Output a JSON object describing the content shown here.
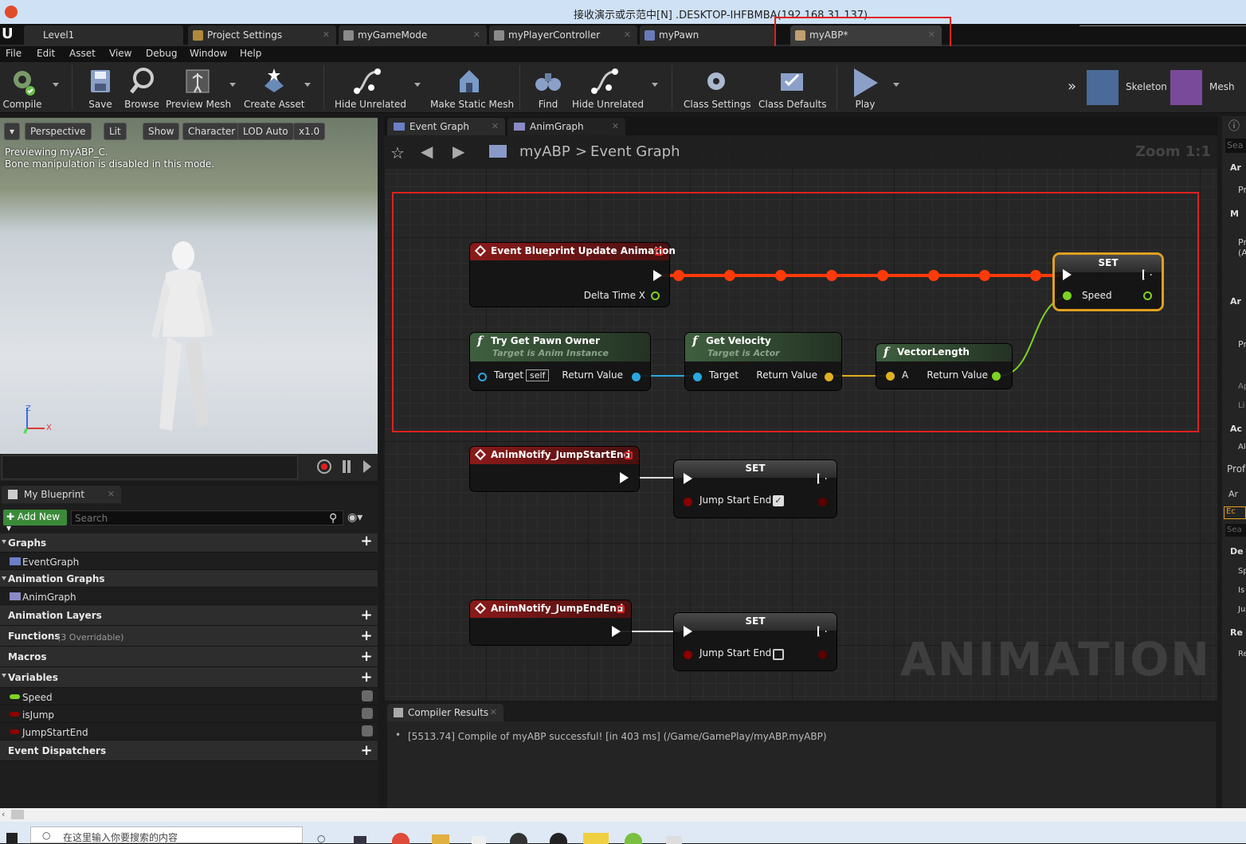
{
  "window": {
    "title": "接收演示或示范中[N] .DESKTOP-IHFBMBA(192.168.31.137)"
  },
  "tabs": [
    {
      "label": "Level1",
      "active": false
    },
    {
      "label": "Project Settings",
      "active": false
    },
    {
      "label": "myGameMode",
      "active": false
    },
    {
      "label": "myPlayerController",
      "active": false
    },
    {
      "label": "myPawn",
      "active": false
    },
    {
      "label": "myABP*",
      "active": true
    }
  ],
  "menu": [
    "File",
    "Edit",
    "Asset",
    "View",
    "Debug",
    "Window",
    "Help"
  ],
  "toolbar": {
    "compile": "Compile",
    "save": "Save",
    "browse": "Browse",
    "preview_mesh": "Preview Mesh",
    "create_asset": "Create Asset",
    "hide_unrelated": "Hide Unrelated",
    "make_static_mesh": "Make Static Mesh",
    "find": "Find",
    "hide_unrelated2": "Hide Unrelated",
    "class_settings": "Class Settings",
    "class_defaults": "Class Defaults",
    "play": "Play",
    "skeleton": "Skeleton",
    "mesh": "Mesh"
  },
  "viewport": {
    "perspective": "Perspective",
    "lit": "Lit",
    "show": "Show",
    "character": "Character",
    "lod": "LOD Auto",
    "speed": "x1.0",
    "preview_line1": "Previewing myABP_C.",
    "preview_line2": "Bone manipulation is disabled in this mode.",
    "axis_z": "Z",
    "axis_x": "X",
    "axis_y": "Y"
  },
  "mybp": {
    "tab": "My Blueprint",
    "add_new": "Add New",
    "search_placeholder": "Search",
    "graphs": "Graphs",
    "event_graph": "EventGraph",
    "anim_graphs": "Animation Graphs",
    "anim_graph": "AnimGraph",
    "anim_layers": "Animation Layers",
    "functions": "Functions",
    "functions_note": "(3 Overridable)",
    "macros": "Macros",
    "variables": "Variables",
    "vars": [
      {
        "name": "Speed",
        "color": "#7ed321"
      },
      {
        "name": "isJump",
        "color": "#8b0000"
      },
      {
        "name": "JumpStartEnd",
        "color": "#8b0000"
      }
    ],
    "dispatchers": "Event Dispatchers"
  },
  "graph": {
    "tab1": "Event Graph",
    "tab2": "AnimGraph",
    "crumb_root": "myABP",
    "crumb_sep": ">",
    "crumb_leaf": "Event Graph",
    "zoom": "Zoom 1:1",
    "watermark": "ANIMATION",
    "n_update": {
      "title": "Event Blueprint Update Animation",
      "pin": "Delta Time X"
    },
    "n_set1": {
      "title": "SET",
      "pin": "Speed"
    },
    "n_pawn": {
      "title": "Try Get Pawn Owner",
      "sub": "Target is Anim Instance",
      "pin_in": "Target",
      "self": "self",
      "pin_out": "Return Value"
    },
    "n_vel": {
      "title": "Get Velocity",
      "sub": "Target is Actor",
      "pin_in": "Target",
      "pin_out": "Return Value"
    },
    "n_len": {
      "title": "VectorLength",
      "pin_in": "A",
      "pin_out": "Return Value"
    },
    "n_js": {
      "title": "AnimNotify_JumpStartEnd"
    },
    "n_set2": {
      "title": "SET",
      "pin": "Jump Start End",
      "checked": true
    },
    "n_je": {
      "title": "AnimNotify_JumpEndEnd"
    },
    "n_set3": {
      "title": "SET",
      "pin": "Jump Start End",
      "checked": false
    }
  },
  "compiler": {
    "tab": "Compiler Results",
    "message": "[5513.74] Compile of myABP successful! [in 403 ms] (/Game/GamePlay/myABP.myABP)"
  },
  "right": {
    "items": [
      "Sea",
      "Ar",
      "Pr",
      "M",
      "Pr (A",
      "Ar",
      "Pr",
      "Ap",
      "Li",
      "Ac",
      "Al",
      "Prof",
      "Ar",
      "Ec",
      "Sea",
      "De",
      "Sp",
      "Is",
      "Ju",
      "Re",
      "Re"
    ]
  },
  "taskbar": {
    "search_placeholder": "在这里输入你要搜索的内容"
  }
}
